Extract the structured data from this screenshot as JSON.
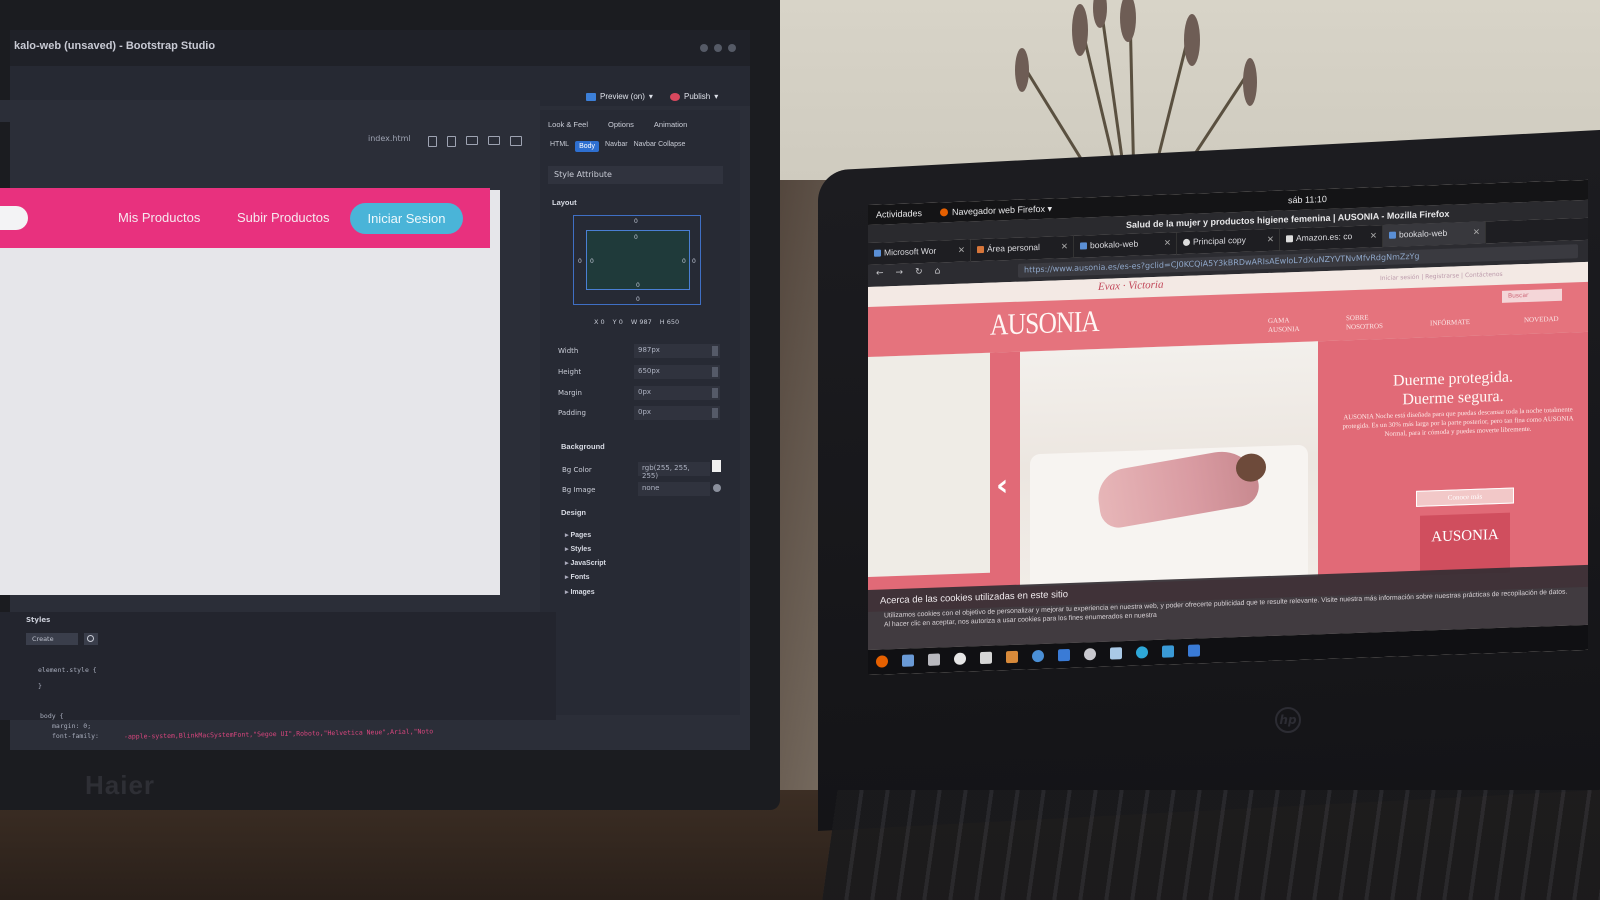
{
  "left_monitor": {
    "brand": "Haier",
    "window_title": "kalo-web (unsaved) - Bootstrap Studio",
    "toolbar": {
      "preview_label": "Preview (on)",
      "publish_label": "Publish"
    },
    "page_select": "index.html",
    "canvas": {
      "nav_links": [
        "Mis Productos",
        "Subir Productos"
      ],
      "cta_label": "Iniciar Sesion"
    },
    "inspector": {
      "tabs": [
        "Look & Feel",
        "Options",
        "Animation"
      ],
      "breadcrumbs": [
        "HTML",
        "Body",
        "Navbar",
        "Navbar Collapse"
      ],
      "style_attribute": "Style Attribute",
      "layout_heading": "Layout",
      "box_values": [
        "0",
        "0",
        "0",
        "0",
        "0",
        "0",
        "0",
        "0"
      ],
      "xywh": {
        "x": "X 0",
        "y": "Y 0",
        "w": "W 987",
        "h": "H 650"
      },
      "properties": [
        {
          "label": "Width",
          "value": "987px"
        },
        {
          "label": "Height",
          "value": "650px"
        },
        {
          "label": "Margin",
          "value": "0px"
        },
        {
          "label": "Padding",
          "value": "0px"
        }
      ],
      "background_heading": "Background",
      "bg_color": {
        "label": "Bg Color",
        "value": "rgb(255, 255, 255)"
      },
      "bg_image": {
        "label": "Bg Image",
        "value": "none"
      },
      "design_heading": "Design",
      "design_items": [
        "Pages",
        "Styles",
        "JavaScript",
        "Fonts",
        "Images"
      ]
    },
    "styles_panel": {
      "title": "Styles",
      "create_label": "Create",
      "code_lines": [
        "element.style {",
        "}",
        "body {",
        "  margin: 0;",
        "  font-family:"
      ],
      "font_stack": "-apple-system,BlinkMacSystemFont,\"Segoe UI\",Roboto,\"Helvetica Neue\",Arial,\"Noto"
    }
  },
  "laptop": {
    "gnome": {
      "activities": "Actividades",
      "app": "Navegador web Firefox",
      "clock": "sáb 11:10"
    },
    "firefox_title": "Salud de la mujer y productos higiene femenina | AUSONIA - Mozilla Firefox",
    "tabs": [
      "Microsoft Wor",
      "Área personal",
      "bookalo-web",
      "Principal copy",
      "Amazon.es: co",
      "bookalo-web"
    ],
    "url": "https://www.ausonia.es/es-es?gclid=CJ0KCQiA5Y3kBRDwARIsAEwloL7dXuNZYVTNvMfvRdgNmZzYg",
    "site": {
      "topbar_brands": "Evax  ·  Victoria",
      "topbar_links": "Iniciar sesión  |  Registrarse  |  Contáctenos",
      "logo": "AUSONIA",
      "nav": [
        "GAMA AUSONIA",
        "SOBRE NOSOTROS",
        "INFÓRMATE",
        "NOVEDAD"
      ],
      "search": "Buscar",
      "hero_title_1": "Duerme protegida.",
      "hero_title_2": "Duerme segura.",
      "hero_copy": "AUSONIA Noche está diseñada para que puedas descansar toda la noche totalmente protegida. Es un 30% más larga por la parte posterior, pero tan fina como AUSONIA Normal, para ir cómoda y puedes moverte libremente.",
      "hero_button": "Conoce más",
      "pack_label": "AUSONIA"
    },
    "cookie": {
      "title": "Acerca de las cookies utilizadas en este sitio",
      "body": "Utilizamos cookies con el objetivo de personalizar y mejorar tu experiencia en nuestra web, y poder ofrecerte publicidad que te resulte relevante. Visite nuestra más información sobre nuestras prácticas de recopilación de datos. Al hacer clic en aceptar, nos autoriza a usar cookies para los fines enumerados en nuestra"
    },
    "brand": "hp"
  }
}
